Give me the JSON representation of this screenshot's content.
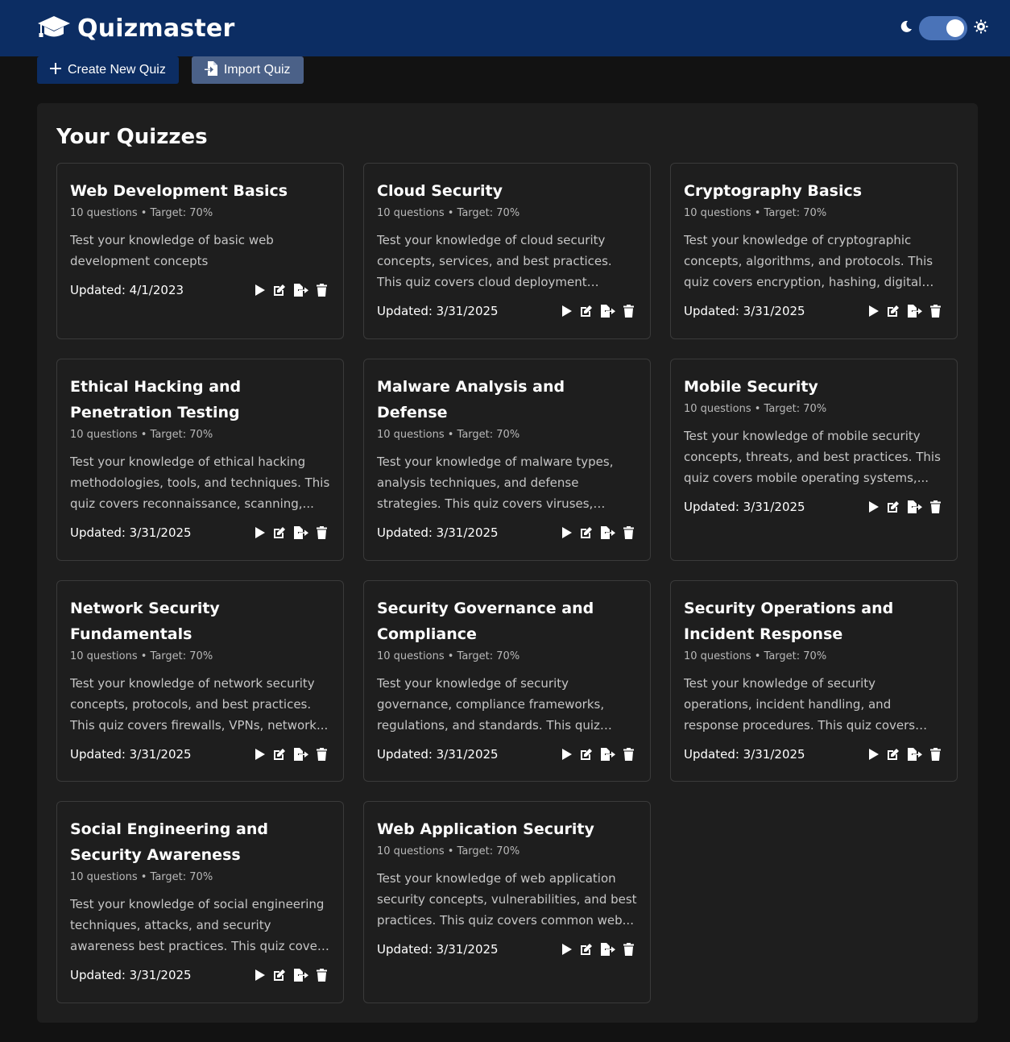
{
  "app": {
    "title": "Quizmaster"
  },
  "actions": {
    "create_label": "Create New Quiz",
    "import_label": "Import Quiz"
  },
  "section": {
    "title": "Your Quizzes"
  },
  "quizzes": [
    {
      "title": "Web Development Basics",
      "meta": "10 questions • Target: 70%",
      "description": "Test your knowledge of basic web development concepts",
      "updated": "Updated: 4/1/2023"
    },
    {
      "title": "Cloud Security",
      "meta": "10 questions • Target: 70%",
      "description": "Test your knowledge of cloud security concepts, services, and best practices. This quiz covers cloud deployment models, shar...",
      "updated": "Updated: 3/31/2025"
    },
    {
      "title": "Cryptography Basics",
      "meta": "10 questions • Target: 70%",
      "description": "Test your knowledge of cryptographic concepts, algorithms, and protocols. This quiz covers encryption, hashing, digital signature...",
      "updated": "Updated: 3/31/2025"
    },
    {
      "title": "Ethical Hacking and Penetration Testing",
      "meta": "10 questions • Target: 70%",
      "description": "Test your knowledge of ethical hacking methodologies, tools, and techniques. This quiz covers reconnaissance, scanning,...",
      "updated": "Updated: 3/31/2025"
    },
    {
      "title": "Malware Analysis and Defense",
      "meta": "10 questions • Target: 70%",
      "description": "Test your knowledge of malware types, analysis techniques, and defense strategies. This quiz covers viruses, worms, trojans,...",
      "updated": "Updated: 3/31/2025"
    },
    {
      "title": "Mobile Security",
      "meta": "10 questions • Target: 70%",
      "description": "Test your knowledge of mobile security concepts, threats, and best practices. This quiz covers mobile operating systems,...",
      "updated": "Updated: 3/31/2025"
    },
    {
      "title": "Network Security Fundamentals",
      "meta": "10 questions • Target: 70%",
      "description": "Test your knowledge of network security concepts, protocols, and best practices. This quiz covers firewalls, VPNs, network...",
      "updated": "Updated: 3/31/2025"
    },
    {
      "title": "Security Governance and Compliance",
      "meta": "10 questions • Target: 70%",
      "description": "Test your knowledge of security governance, compliance frameworks, regulations, and standards. This quiz covers risk managemen...",
      "updated": "Updated: 3/31/2025"
    },
    {
      "title": "Security Operations and Incident Response",
      "meta": "10 questions • Target: 70%",
      "description": "Test your knowledge of security operations, incident handling, and response procedures. This quiz covers SOC operations, incident...",
      "updated": "Updated: 3/31/2025"
    },
    {
      "title": "Social Engineering and Security Awareness",
      "meta": "10 questions • Target: 70%",
      "description": "Test your knowledge of social engineering techniques, attacks, and security awareness best practices. This quiz covers phishing,...",
      "updated": "Updated: 3/31/2025"
    },
    {
      "title": "Web Application Security",
      "meta": "10 questions • Target: 70%",
      "description": "Test your knowledge of web application security concepts, vulnerabilities, and best practices. This quiz covers common web...",
      "updated": "Updated: 3/31/2025"
    }
  ],
  "icons": {
    "brand": "graduation-cap-icon",
    "theme_dark": "moon-icon",
    "theme_light": "sun-icon",
    "card_actions": [
      "play-icon",
      "edit-icon",
      "export-icon",
      "trash-icon"
    ]
  },
  "colors": {
    "header_bg": "#0c2d63",
    "page_bg": "#121212",
    "panel_bg": "#1e1e1e",
    "card_border": "#3a3a3a",
    "primary_button": "#0c2d63",
    "secondary_button": "#4b6188",
    "toggle_bg": "#4a73b8"
  }
}
